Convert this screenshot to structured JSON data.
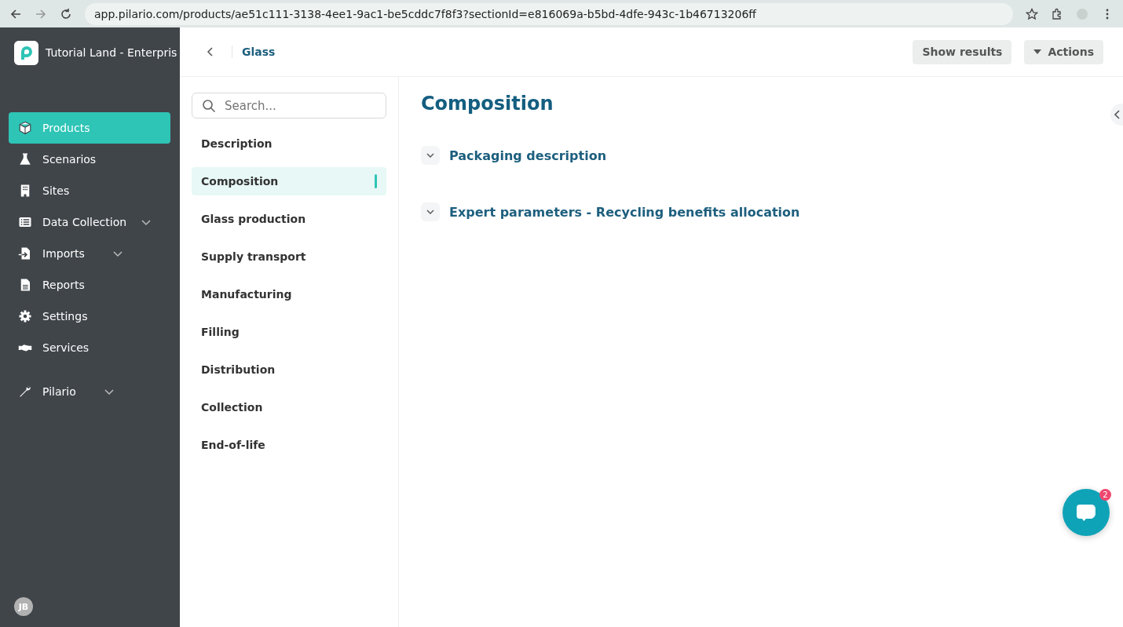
{
  "browser": {
    "url": "app.pilario.com/products/ae51c111-3138-4ee1-9ac1-be5cddc7f8f3?sectionId=e816069a-b5bd-4dfe-943c-1b46713206ff"
  },
  "sidebar": {
    "org": "Tutorial Land - Enterpris",
    "items": [
      {
        "label": "Products",
        "selected": true,
        "expandable": false
      },
      {
        "label": "Scenarios",
        "selected": false,
        "expandable": false
      },
      {
        "label": "Sites",
        "selected": false,
        "expandable": false
      },
      {
        "label": "Data Collection",
        "selected": false,
        "expandable": true
      },
      {
        "label": "Imports",
        "selected": false,
        "expandable": true
      },
      {
        "label": "Reports",
        "selected": false,
        "expandable": false
      },
      {
        "label": "Settings",
        "selected": false,
        "expandable": false
      },
      {
        "label": "Services",
        "selected": false,
        "expandable": false
      }
    ],
    "footer_items": [
      {
        "label": "Pilario",
        "selected": false,
        "expandable": true
      }
    ],
    "avatar": "JB"
  },
  "header": {
    "breadcrumb": "Glass",
    "buttons": [
      {
        "label": "Show results",
        "kind": "plain"
      },
      {
        "label": "Actions",
        "kind": "dropdown"
      }
    ]
  },
  "sections_nav": {
    "search": {
      "placeholder": "Search..."
    },
    "items": [
      {
        "label": "Description",
        "selected": false
      },
      {
        "label": "Composition",
        "selected": true
      },
      {
        "label": "Glass production",
        "selected": false
      },
      {
        "label": "Supply transport",
        "selected": false
      },
      {
        "label": "Manufacturing",
        "selected": false
      },
      {
        "label": "Filling",
        "selected": false
      },
      {
        "label": "Distribution",
        "selected": false
      },
      {
        "label": "Collection",
        "selected": false
      },
      {
        "label": "End-of-life",
        "selected": false
      }
    ]
  },
  "content": {
    "title": "Composition",
    "panels": [
      {
        "title": "Packaging description",
        "expanded": false
      },
      {
        "title": "Expert parameters - Recycling benefits allocation",
        "expanded": false
      }
    ]
  },
  "chat": {
    "badge": "2"
  }
}
